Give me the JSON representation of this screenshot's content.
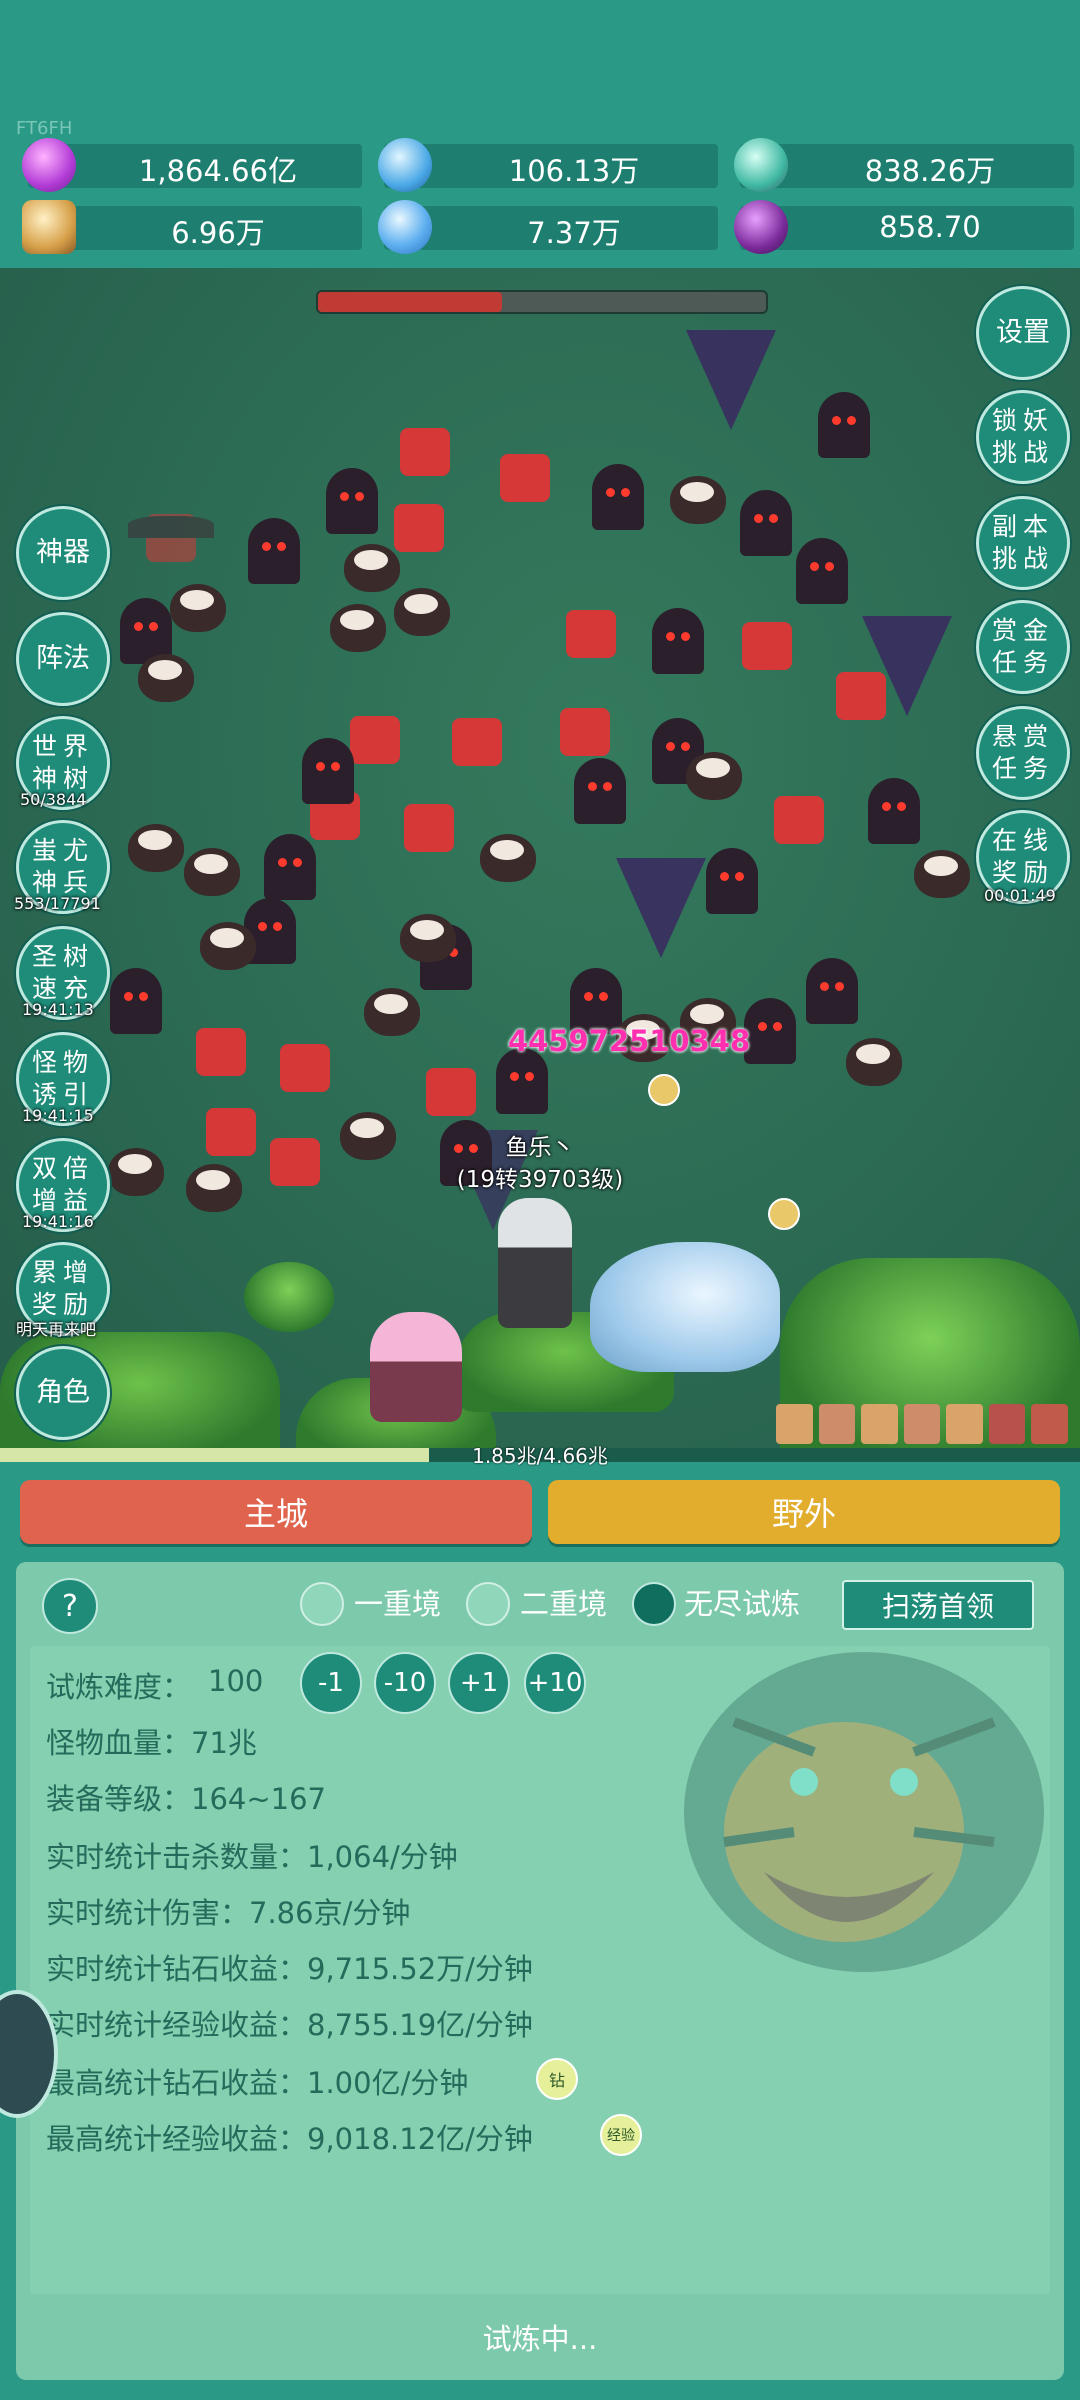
{
  "top_tag": "FT6FH",
  "resources": [
    {
      "icon": "diamond-icon",
      "value": "1,864.66亿"
    },
    {
      "icon": "blue-orb-icon",
      "value": "106.13万"
    },
    {
      "icon": "teal-gem-icon",
      "value": "838.26万"
    },
    {
      "icon": "scroll-icon",
      "value": "6.96万"
    },
    {
      "icon": "ice-crystal-icon",
      "value": "7.37万"
    },
    {
      "icon": "purple-pouch-icon",
      "value": "858.70"
    }
  ],
  "boss_hp_fraction": 0.41,
  "left_menu": [
    {
      "label": "神器",
      "sub": ""
    },
    {
      "label": "阵法",
      "sub": ""
    },
    {
      "label": "世界神树",
      "sub": "50/3844"
    },
    {
      "label": "蚩尤神兵",
      "sub": "553/17791"
    },
    {
      "label": "圣树速充",
      "sub": "19:41:13"
    },
    {
      "label": "怪物诱引",
      "sub": "19:41:15"
    },
    {
      "label": "双倍增益",
      "sub": "19:41:16"
    },
    {
      "label": "累增奖励",
      "sub": "明天再来吧"
    },
    {
      "label": "角色",
      "sub": ""
    }
  ],
  "right_menu": [
    {
      "label": "设置",
      "sub": ""
    },
    {
      "label": "锁妖挑战",
      "sub": ""
    },
    {
      "label": "副本挑战",
      "sub": ""
    },
    {
      "label": "赏金任务",
      "sub": ""
    },
    {
      "label": "悬赏任务",
      "sub": ""
    },
    {
      "label": "在线奖励",
      "sub": "00:01:49"
    }
  ],
  "damage_number": "445972510348",
  "player": {
    "name": "鱼乐丶",
    "level": "(19转39703级)"
  },
  "xp": {
    "text": "1.85兆/4.66兆",
    "fraction": 0.397
  },
  "nav": {
    "main_city": "主城",
    "wild": "野外"
  },
  "panel": {
    "help": "?",
    "modes": [
      {
        "label": "一重境",
        "selected": false
      },
      {
        "label": "二重境",
        "selected": false
      },
      {
        "label": "无尽试炼",
        "selected": true
      }
    ],
    "sweep_button": "扫荡首领",
    "difficulty_label": "试炼难度：",
    "difficulty_value": "100",
    "adjust_buttons": [
      "-1",
      "-10",
      "+1",
      "+10"
    ],
    "stats": [
      "怪物血量：71兆",
      "装备等级：164~167",
      "实时统计击杀数量：1,064/分钟",
      "实时统计伤害：7.86京/分钟",
      "实时统计钻石收益：9,715.52万/分钟",
      "实时统计经验收益：8,755.19亿/分钟",
      "最高统计钻石收益：1.00亿/分钟",
      "最高统计经验收益：9,018.12亿/分钟"
    ],
    "badges": [
      "钻",
      "经验"
    ],
    "footer": "试炼中..."
  },
  "colors": {
    "background": "#2a9a87",
    "main_city_button": "#e0634e",
    "wild_button": "#e2ac2c",
    "damage_text": "#ff2fb0"
  }
}
